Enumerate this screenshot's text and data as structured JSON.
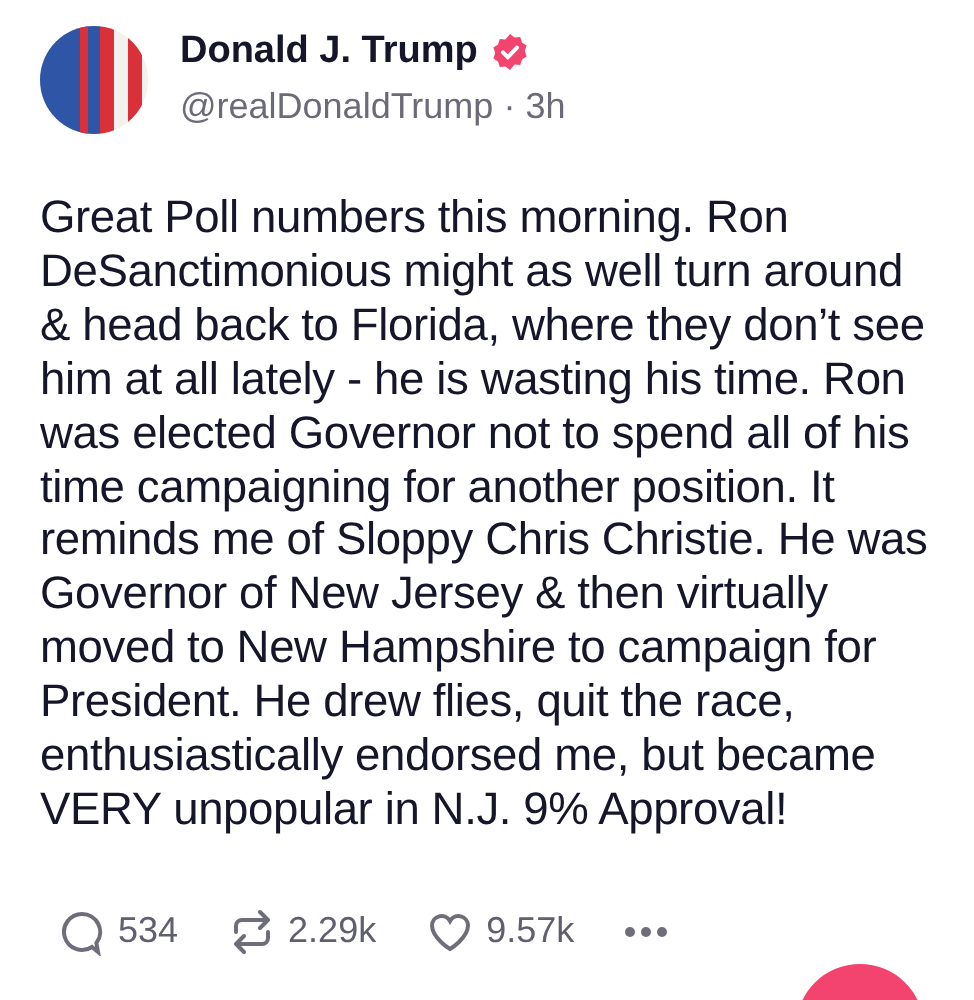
{
  "author": {
    "name": "Donald J. Trump",
    "verified": true,
    "handle": "@realDonaldTrump",
    "separator": "·",
    "time": "3h"
  },
  "post": {
    "lines": [
      "Great Poll numbers this morning. Ron",
      "DeSanctimonious might as well turn around",
      "& head back to Florida, where they don’t see",
      "him at all lately - he is wasting his time. Ron",
      "was elected Governor not to spend all of his",
      "time campaigning for another position. It",
      "reminds me of Sloppy Chris Christie. He was",
      "Governor of New Jersey & then virtually",
      "moved to New Hampshire to campaign for",
      "President. He drew flies, quit the race,",
      "enthusiastically endorsed me, but became",
      "VERY unpopular in N.J. 9% Approval!"
    ]
  },
  "actions": [
    {
      "kind": "reply",
      "count": "534"
    },
    {
      "kind": "repost",
      "count": "2.29k"
    },
    {
      "kind": "like",
      "count": "9.57k"
    },
    {
      "kind": "more"
    }
  ]
}
